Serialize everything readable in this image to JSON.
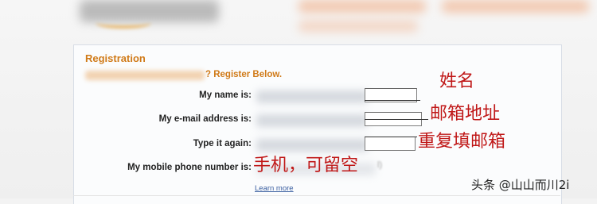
{
  "header": {
    "logo_text": "amazon.com"
  },
  "registration": {
    "title": "Registration",
    "subtitle_suffix": "? Register Below.",
    "fields": [
      {
        "label": "My name is:",
        "annotation": "姓名"
      },
      {
        "label": "My e-mail address is:",
        "annotation": "邮箱地址"
      },
      {
        "label": "Type it again:",
        "annotation": "重复填邮箱"
      },
      {
        "label": "My mobile phone number is:",
        "annotation": "手机，可留空",
        "suffix": "l)"
      }
    ],
    "learn_more": "Learn more"
  },
  "watermark": "头条 @山山而川2i",
  "colors": {
    "heading": "#d07a18",
    "annotation": "#c01818",
    "link": "#3a5fa0"
  }
}
